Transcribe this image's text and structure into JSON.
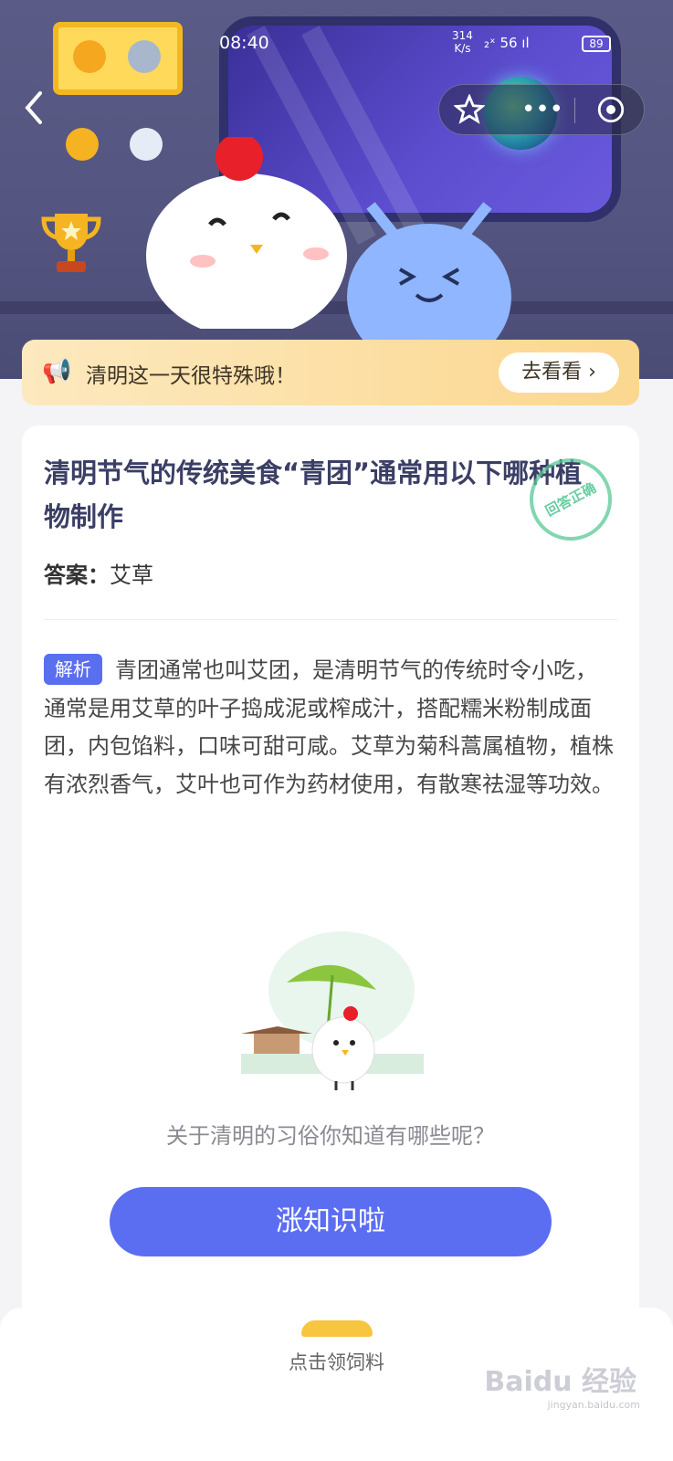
{
  "status_bar": {
    "time": "08:40",
    "net_speed": "314",
    "net_unit": "K/s",
    "signal": "₂ˣ 56 ıl",
    "battery": "89"
  },
  "header": {
    "back_icon": "chevron-left-icon",
    "actions": [
      {
        "icon": "star-icon"
      },
      {
        "icon": "more-dots-icon"
      },
      {
        "icon": "close-target-icon"
      }
    ]
  },
  "notice": {
    "icon": "megaphone-icon",
    "text": "清明这一天很特殊哦！",
    "button": "去看看 ›"
  },
  "question": {
    "title": "清明节气的传统美食“青团”通常用以下哪种植物制作",
    "stamp": "回答正确",
    "answer_label": "答案：",
    "answer_value": "艾草",
    "analysis_tag": "解析",
    "analysis_text": "青团通常也叫艾团，是清明节气的传统时令小吃，通常是用艾草的叶子捣成泥或榨成汁，搭配糯米粉制成面团，内包馅料，口味可甜可咸。艾草为菊科蒿属植物，植株有浓烈香气，艾叶也可作为药材使用，有散寒祛湿等功效。",
    "prompt": "关于清明的习俗你知道有哪些呢？",
    "cta": "涨知识啦"
  },
  "bottom": {
    "label": "点击领饲料",
    "watermark": "Baidu 经验",
    "watermark_sub": "jingyan.baidu.com"
  },
  "colors": {
    "accent": "#5b6ef2",
    "notice_bg": "#fbd78f",
    "title": "#3b3f66"
  }
}
